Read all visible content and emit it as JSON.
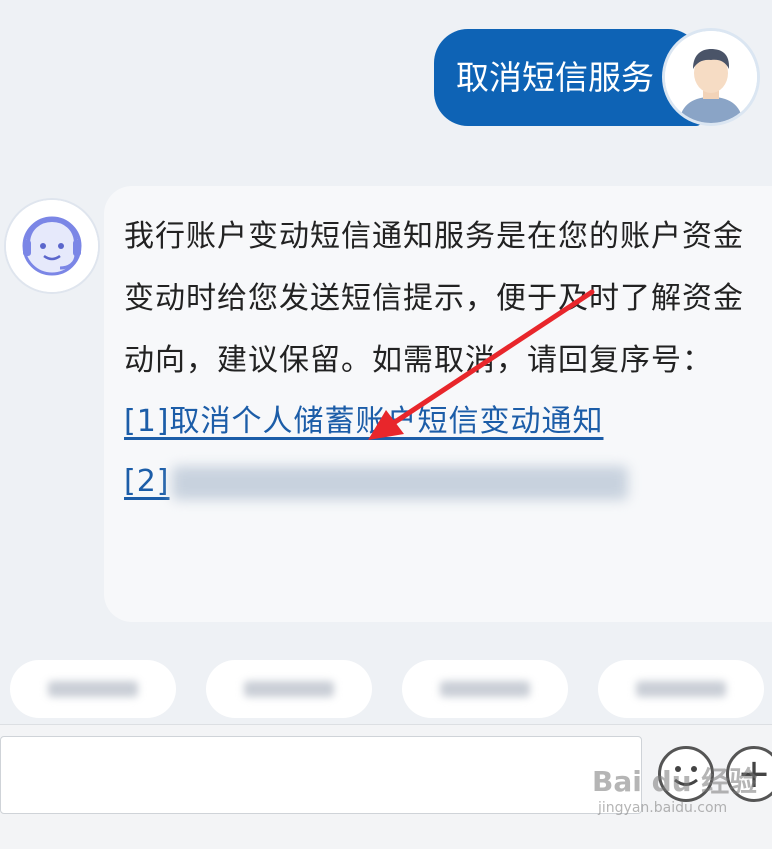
{
  "user_message": {
    "text": "取消短信服务"
  },
  "bot_message": {
    "text": "我行账户变动短信通知服务是在您的账户资金变动时给您发送短信提示，便于及时了解资金动向，建议保留。如需取消，请回复序号：",
    "options": [
      {
        "number": "[1]",
        "label": "取消个人储蓄账户短信变动通知"
      },
      {
        "number": "[2]",
        "label": ""
      }
    ]
  },
  "colors": {
    "user_bubble": "#0e63b5",
    "link": "#1c5da8",
    "arrow": "#e8262b"
  },
  "icons": {
    "user": "user-avatar",
    "bot": "bot-avatar-headset",
    "emoji": "emoji-icon",
    "plus": "plus-icon"
  },
  "watermark": {
    "brand": "Bai du 经验",
    "url": "jingyan.baidu.com"
  }
}
